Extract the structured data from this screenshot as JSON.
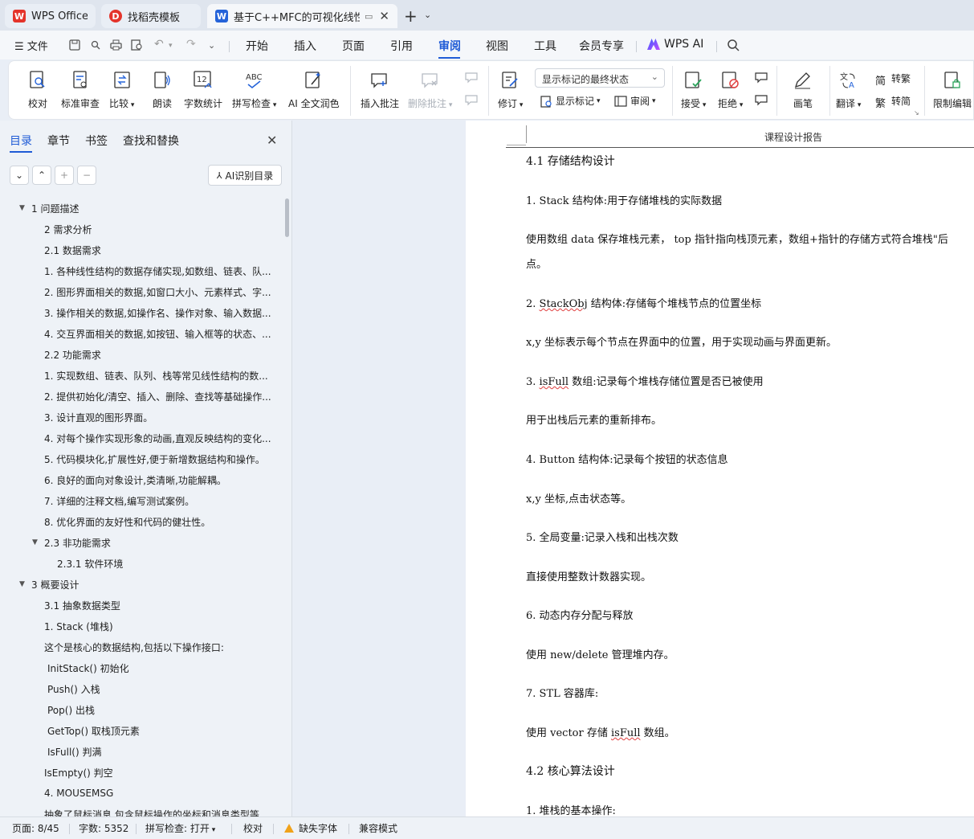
{
  "tabs": [
    {
      "label": "WPS Office",
      "logo": "W",
      "color": "#e4342b"
    },
    {
      "label": "找稻壳模板",
      "logo": "D",
      "color": "#e4342b"
    },
    {
      "label": "基于C++MFC的可视化线性表",
      "logo": "W",
      "color": "#2563d9"
    }
  ],
  "menu": {
    "file": "文件",
    "items": [
      "开始",
      "插入",
      "页面",
      "引用",
      "审阅",
      "视图",
      "工具",
      "会员专享"
    ],
    "active": "审阅",
    "wps_ai": "WPS AI"
  },
  "ribbon": {
    "proofread": "校对",
    "standard_review": "标准审查",
    "compare": "比较",
    "read_aloud": "朗读",
    "word_count": "字数统计",
    "spell_check": "拼写检查",
    "ai_proofread": "AI 全文润色",
    "insert_comment": "插入批注",
    "delete_comment": "删除批注",
    "track_changes": "修订",
    "markup_select": "显示标记的最终状态",
    "show_markup": "显示标记",
    "reviewing": "审阅",
    "accept": "接受",
    "reject": "拒绝",
    "pen": "画笔",
    "translate": "翻译",
    "to_traditional": "转繁",
    "to_simplified": "转简",
    "restrict_edit": "限制编辑"
  },
  "nav": {
    "tabs": [
      "目录",
      "章节",
      "书签",
      "查找和替换"
    ],
    "ai_toc": "AI识别目录",
    "toc": [
      {
        "text": "1 问题描述",
        "level": 0,
        "arrow": true
      },
      {
        "text": "2 需求分析",
        "level": 1
      },
      {
        "text": "2.1 数据需求",
        "level": 1
      },
      {
        "text": "1. 各种线性结构的数据存储实现,如数组、链表、队...",
        "level": 1
      },
      {
        "text": "2. 图形界面相关的数据,如窗口大小、元素样式、字...",
        "level": 1
      },
      {
        "text": "3. 操作相关的数据,如操作名、操作对象、输入数据...",
        "level": 1
      },
      {
        "text": "4. 交互界面相关的数据,如按钮、输入框等的状态、...",
        "level": 1
      },
      {
        "text": "2.2 功能需求",
        "level": 1
      },
      {
        "text": "1. 实现数组、链表、队列、栈等常见线性结构的数...",
        "level": 1
      },
      {
        "text": "2. 提供初始化/清空、插入、删除、查找等基础操作...",
        "level": 1
      },
      {
        "text": "3. 设计直观的图形界面。",
        "level": 1
      },
      {
        "text": "4. 对每个操作实现形象的动画,直观反映结构的变化...",
        "level": 1
      },
      {
        "text": "5. 代码模块化,扩展性好,便于新增数据结构和操作。",
        "level": 1
      },
      {
        "text": "6. 良好的面向对象设计,类清晰,功能解耦。",
        "level": 1
      },
      {
        "text": "7. 详细的注释文档,编写测试案例。",
        "level": 1
      },
      {
        "text": "8. 优化界面的友好性和代码的健壮性。",
        "level": 1
      },
      {
        "text": "2.3 非功能需求",
        "level": 1,
        "arrow": true
      },
      {
        "text": "2.3.1 软件环境",
        "level": 2
      },
      {
        "text": "3 概要设计",
        "level": 0,
        "arrow": true
      },
      {
        "text": "3.1 抽象数据类型",
        "level": 1
      },
      {
        "text": "1. Stack (堆栈)",
        "level": 1
      },
      {
        "text": "这个是核心的数据结构,包括以下操作接口:",
        "level": 1
      },
      {
        "text": "InitStack() 初始化",
        "level": 1.25
      },
      {
        "text": "Push() 入栈",
        "level": 1.25
      },
      {
        "text": "Pop() 出栈",
        "level": 1.25
      },
      {
        "text": "GetTop() 取栈顶元素",
        "level": 1.25
      },
      {
        "text": "IsFull() 判满",
        "level": 1.25
      },
      {
        "text": "IsEmpty() 判空",
        "level": 1
      },
      {
        "text": "4. MOUSEMSG",
        "level": 1
      },
      {
        "text": "抽象了鼠标消息,包含鼠标操作的坐标和消息类型等",
        "level": 1
      }
    ]
  },
  "document": {
    "header": "课程设计报告",
    "paragraphs": [
      {
        "text": "4.1  存储结构设计",
        "kind": "h2"
      },
      {
        "text": "1. Stack 结构体:用于存储堆栈的实际数据",
        "kind": "p"
      },
      {
        "text": " 使用数组 data 保存堆栈元素， top 指针指向栈顶元素，数组+指针的存储方式符合堆栈\"后",
        "kind": "p"
      },
      {
        "text": "点。",
        "kind": "p"
      },
      {
        "text": "2. StackObj 结构体:存储每个堆栈节点的位置坐标",
        "kind": "p",
        "wavy": "StackObj"
      },
      {
        "text": " x,y 坐标表示每个节点在界面中的位置，用于实现动画与界面更新。",
        "kind": "p"
      },
      {
        "text": "3. isFull 数组:记录每个堆栈存储位置是否已被使用",
        "kind": "p",
        "wavy": "isFull"
      },
      {
        "text": " 用于出栈后元素的重新排布。",
        "kind": "p"
      },
      {
        "text": "4. Button 结构体:记录每个按钮的状态信息",
        "kind": "p"
      },
      {
        "text": " x,y 坐标,点击状态等。",
        "kind": "p"
      },
      {
        "text": "5. 全局变量:记录入栈和出栈次数",
        "kind": "p"
      },
      {
        "text": " 直接使用整数计数器实现。",
        "kind": "p"
      },
      {
        "text": "6. 动态内存分配与释放",
        "kind": "p"
      },
      {
        "text": " 使用 new/delete 管理堆内存。",
        "kind": "p"
      },
      {
        "text": "7. STL 容器库:",
        "kind": "p"
      },
      {
        "text": " 使用 vector 存储 isFull 数组。",
        "kind": "p",
        "wavy": "isFull"
      },
      {
        "text": "4.2  核心算法设计",
        "kind": "h2"
      },
      {
        "text": "1. 堆栈的基本操作:",
        "kind": "p"
      }
    ]
  },
  "status": {
    "page": "页面: 8/45",
    "words": "字数: 5352",
    "spell": "拼写检查: 打开",
    "proof": "校对",
    "missing_font": "缺失字体",
    "compat": "兼容模式"
  },
  "colors": {
    "accent": "#1f5bd6",
    "wps_red": "#e4342b",
    "warning": "#f0a21a"
  }
}
